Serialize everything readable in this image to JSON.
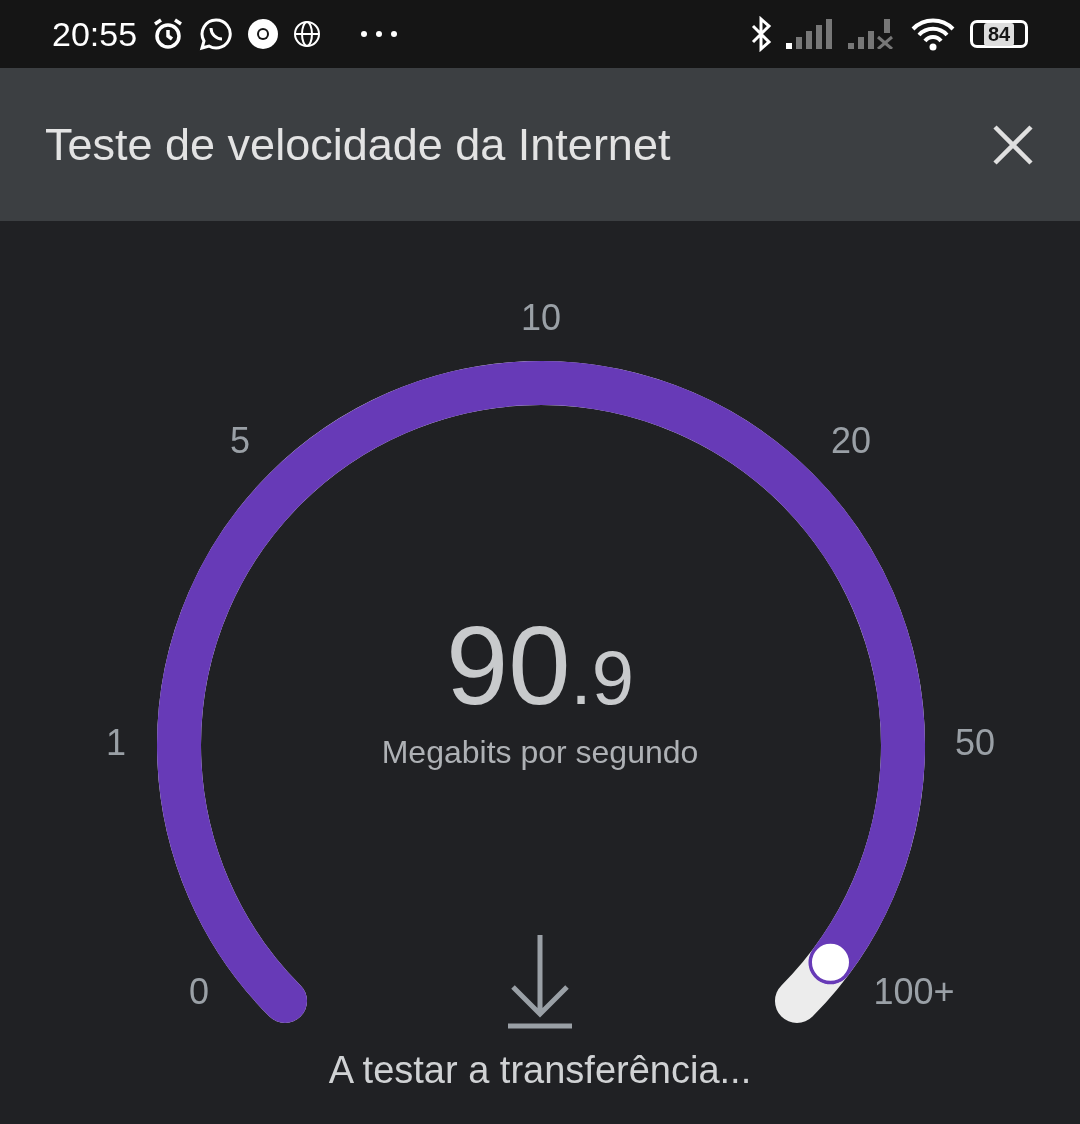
{
  "status_bar": {
    "time": "20:55",
    "battery": "84"
  },
  "header": {
    "title": "Teste de velocidade da Internet"
  },
  "gauge": {
    "ticks": [
      "0",
      "1",
      "5",
      "10",
      "20",
      "50",
      "100+"
    ],
    "value_main": "90",
    "value_decimal": ".9",
    "unit": "Megabits por segundo"
  },
  "progress": {
    "label": "A testar a transferência..."
  }
}
